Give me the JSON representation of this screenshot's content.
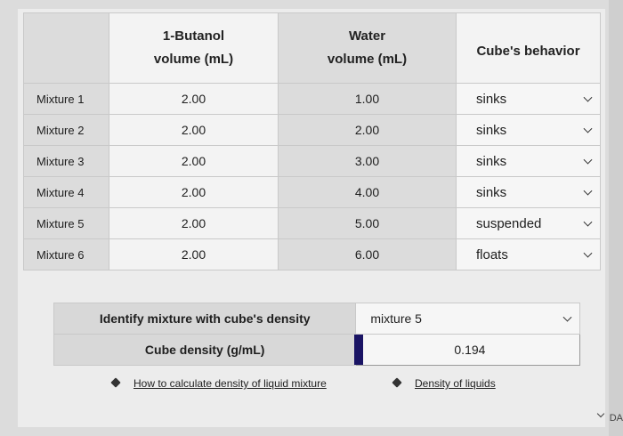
{
  "table": {
    "headers": {
      "butanol_line1": "1-Butanol",
      "butanol_line2": "volume (mL)",
      "water_line1": "Water",
      "water_line2": "volume (mL)",
      "behavior": "Cube's behavior"
    },
    "rows": [
      {
        "name": "Mixture 1",
        "butanol": "2.00",
        "water": "1.00",
        "behavior": "sinks"
      },
      {
        "name": "Mixture 2",
        "butanol": "2.00",
        "water": "2.00",
        "behavior": "sinks"
      },
      {
        "name": "Mixture 3",
        "butanol": "2.00",
        "water": "3.00",
        "behavior": "sinks"
      },
      {
        "name": "Mixture 4",
        "butanol": "2.00",
        "water": "4.00",
        "behavior": "sinks"
      },
      {
        "name": "Mixture 5",
        "butanol": "2.00",
        "water": "5.00",
        "behavior": "suspended"
      },
      {
        "name": "Mixture 6",
        "butanol": "2.00",
        "water": "6.00",
        "behavior": "floats"
      }
    ]
  },
  "identify": {
    "label": "Identify mixture with cube's density",
    "value": "mixture 5"
  },
  "density": {
    "label": "Cube density (g/mL)",
    "value": "0.194"
  },
  "links": {
    "calc": "How to calculate density of liquid mixture",
    "liquids": "Density of liquids"
  },
  "corner_text": "DA"
}
